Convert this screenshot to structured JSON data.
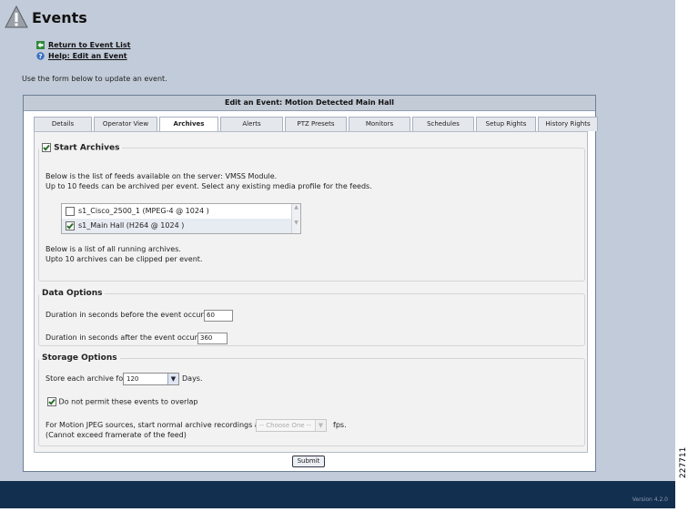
{
  "page": {
    "title": "Events",
    "links": [
      {
        "label": "Return to Event List",
        "icon": "return-arrow-icon"
      },
      {
        "label": "Help: Edit an Event",
        "icon": "help-icon"
      }
    ],
    "intro": "Use the form below to update an event."
  },
  "panel": {
    "header": "Edit an Event: Motion Detected Main Hall",
    "tabs": [
      "Details",
      "Operator View",
      "Archives",
      "Alerts",
      "PTZ Presets",
      "Monitors",
      "Schedules",
      "Setup Rights",
      "History Rights"
    ],
    "active_tab": "Archives"
  },
  "archives": {
    "legend": "Start Archives",
    "checked": true,
    "feeds_text_1": "Below is the list of feeds available on the server: VMSS Module.",
    "feeds_text_2": "Up to 10 feeds can be archived per event. Select any existing media profile for the feeds.",
    "feeds": [
      {
        "label": "s1_Cisco_2500_1 (MPEG-4 @ 1024 )",
        "checked": false
      },
      {
        "label": "s1_Main Hall (H264 @ 1024 )",
        "checked": true
      }
    ],
    "running_text_1": "Below is a list of all running archives.",
    "running_text_2": "Upto 10 archives can be clipped per event."
  },
  "data_options": {
    "legend": "Data Options",
    "before_label": "Duration in seconds before the event occurrs :",
    "before_value": "60",
    "after_label": "Duration in seconds after the event occurrs :",
    "after_value": "360"
  },
  "storage_options": {
    "legend": "Storage Options",
    "store_label": "Store each archive for:",
    "store_value": "120",
    "store_unit": "Days.",
    "overlap_label": "Do not permit these events to overlap",
    "overlap_checked": true,
    "mjpeg_label": "For Motion JPEG sources, start normal archive recordings at:",
    "mjpeg_select": "-- Choose One --",
    "mjpeg_unit": "fps.",
    "mjpeg_note": "(Cannot exceed framerate of the feed)"
  },
  "submit_label": "Submit",
  "version": "Version 4.2.0",
  "figure_id": "227711"
}
